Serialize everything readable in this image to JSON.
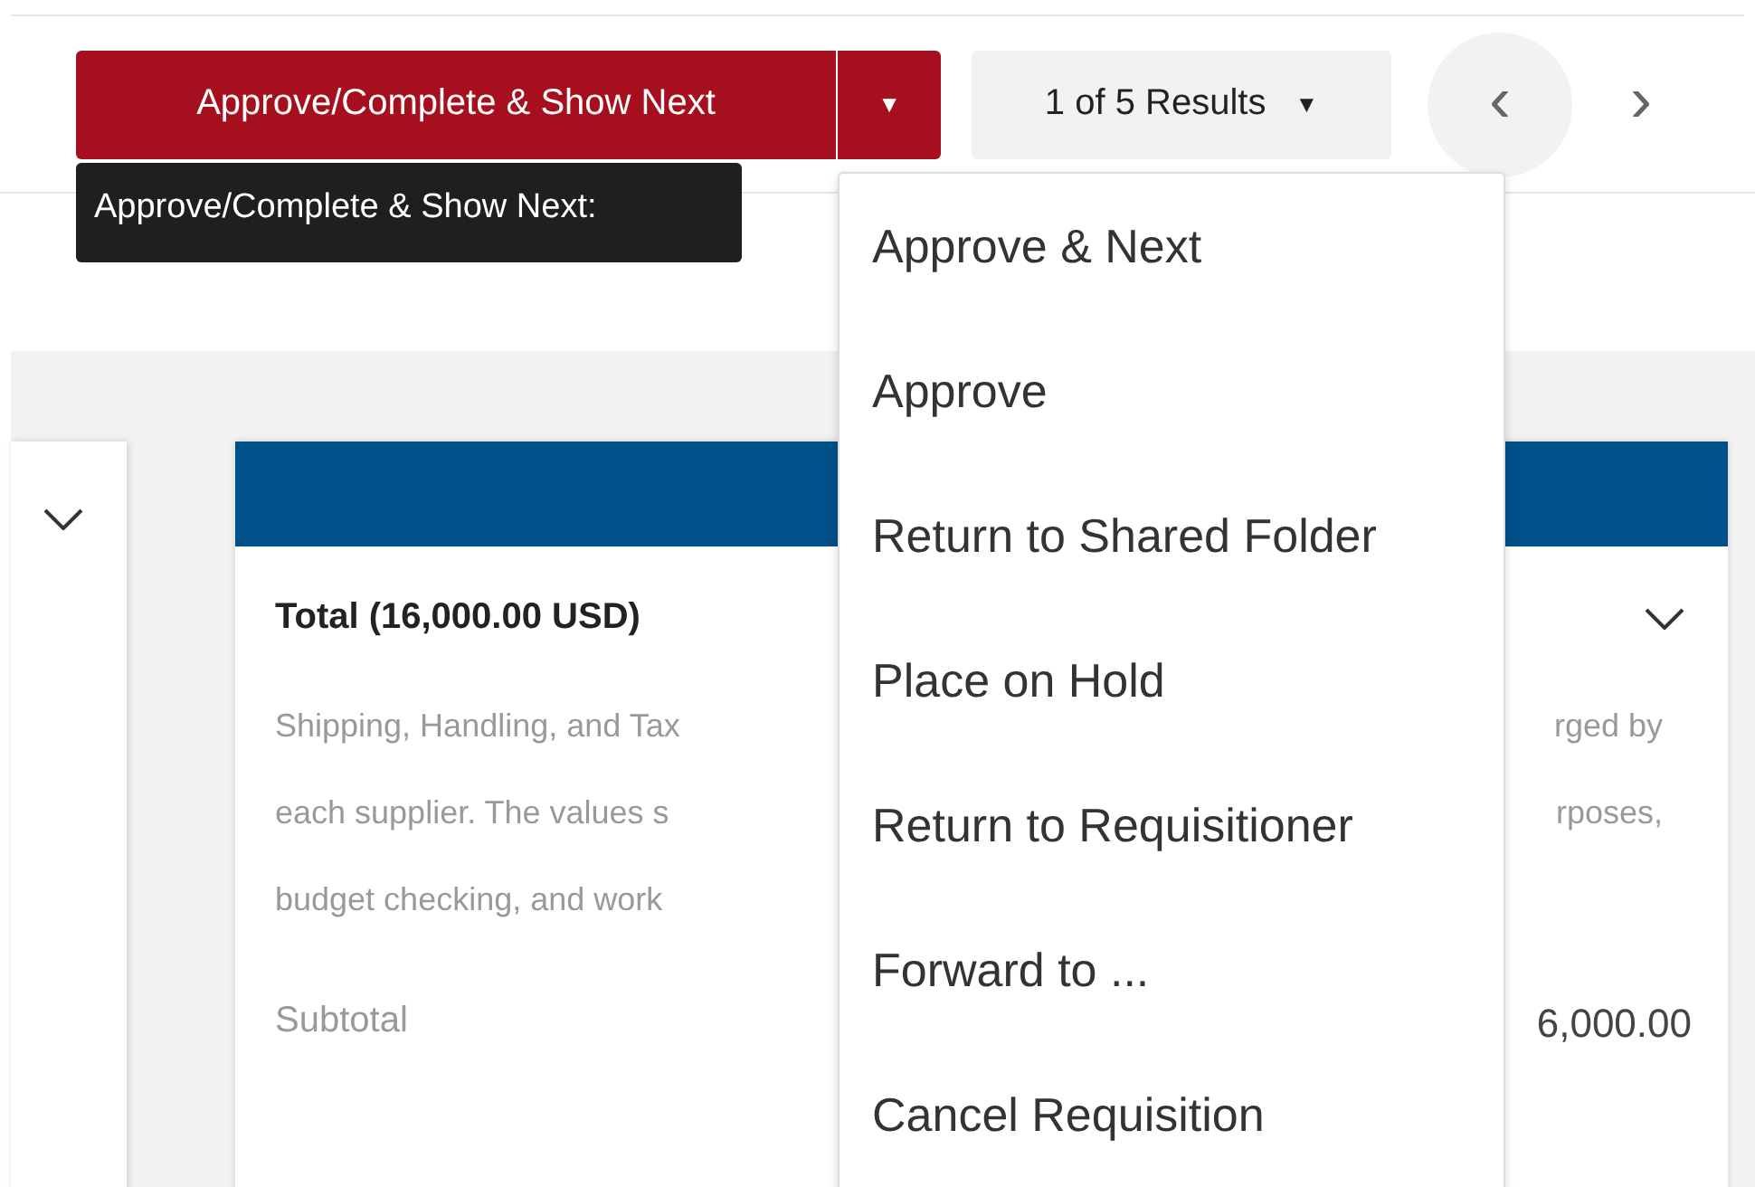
{
  "toolbar": {
    "primary_button": "Approve/Complete & Show Next",
    "dropdown_toggle": "▼",
    "results": "1 of 5 Results",
    "results_caret": "▼",
    "prev": "‹",
    "next": "›"
  },
  "tooltip": "Approve/Complete & Show Next:",
  "menu": {
    "items": [
      {
        "label": "Approve & Next"
      },
      {
        "label": "Approve"
      },
      {
        "label": "Return to Shared Folder"
      },
      {
        "label": "Place on Hold"
      },
      {
        "label": "Return to Requisitioner"
      },
      {
        "label": "Forward to ..."
      },
      {
        "label": "Cancel Requisition"
      }
    ]
  },
  "total_card": {
    "title": "Total (16,000.00 USD)",
    "expanded": true,
    "description_lines": [
      {
        "left": "Shipping, Handling, and Tax",
        "right": "rged by"
      },
      {
        "left": "each supplier. The values s",
        "right": "rposes,"
      },
      {
        "left": "budget checking, and work"
      }
    ],
    "subtotal_label": "Subtotal",
    "subtotal_value": "6,000.00"
  },
  "left_card": {
    "expanded": true
  }
}
